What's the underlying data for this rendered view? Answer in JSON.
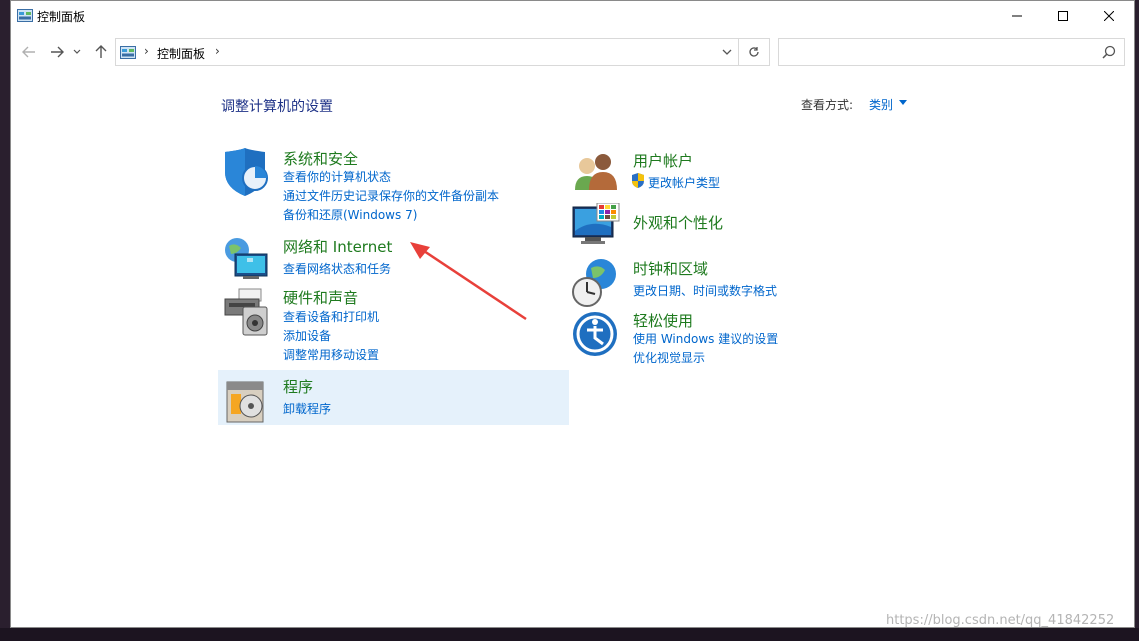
{
  "window": {
    "title": "控制面板"
  },
  "address": {
    "crumb": "控制面板",
    "sep": "›"
  },
  "search": {
    "placeholder": ""
  },
  "main": {
    "title": "调整计算机的设置",
    "view_by_label": "查看方式:",
    "view_by_value": "类别"
  },
  "categories": {
    "system": {
      "heading": "系统和安全",
      "links": [
        "查看你的计算机状态",
        "通过文件历史记录保存你的文件备份副本",
        "备份和还原(Windows 7)"
      ]
    },
    "network": {
      "heading": "网络和 Internet",
      "links": [
        "查看网络状态和任务"
      ]
    },
    "hardware": {
      "heading": "硬件和声音",
      "links": [
        "查看设备和打印机",
        "添加设备",
        "调整常用移动设置"
      ]
    },
    "programs": {
      "heading": "程序",
      "links": [
        "卸载程序"
      ]
    },
    "users": {
      "heading": "用户帐户",
      "links": [
        "更改帐户类型"
      ]
    },
    "appearance": {
      "heading": "外观和个性化",
      "links": []
    },
    "clock": {
      "heading": "时钟和区域",
      "links": [
        "更改日期、时间或数字格式"
      ]
    },
    "ease": {
      "heading": "轻松使用",
      "links": [
        "使用 Windows 建议的设置",
        "优化视觉显示"
      ]
    }
  },
  "watermark": "https://blog.csdn.net/qq_41842252",
  "colors": {
    "heading": "#1e7a1e",
    "link": "#0066cc",
    "title": "#1e3287",
    "highlight": "#e5f1fb",
    "arrow": "#e8403a"
  },
  "icons": [
    "control-panel-icon",
    "minimize-icon",
    "maximize-icon",
    "close-icon",
    "back-arrow-icon",
    "forward-arrow-icon",
    "recent-chevron-icon",
    "up-arrow-icon",
    "refresh-icon",
    "search-icon",
    "shield-icon",
    "network-globe-icon",
    "printer-icon",
    "programs-disk-icon",
    "users-icon",
    "uac-shield-icon",
    "appearance-monitor-icon",
    "clock-globe-icon",
    "ease-of-access-icon",
    "annotation-arrow"
  ]
}
